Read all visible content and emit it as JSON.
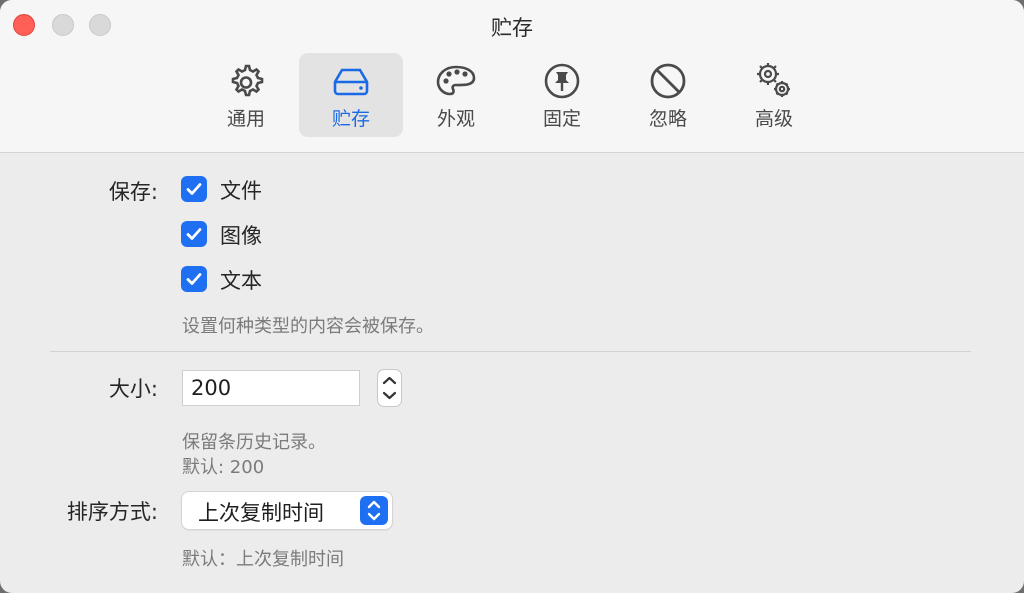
{
  "window": {
    "title": "贮存"
  },
  "tabs": [
    {
      "label": "通用",
      "icon": "gear-icon"
    },
    {
      "label": "贮存",
      "icon": "storage-drive-icon",
      "active": true
    },
    {
      "label": "外观",
      "icon": "palette-icon"
    },
    {
      "label": "固定",
      "icon": "pin-icon"
    },
    {
      "label": "忽略",
      "icon": "prohibited-icon"
    },
    {
      "label": "高级",
      "icon": "gears-icon"
    }
  ],
  "save": {
    "label": "保存:",
    "options": [
      {
        "label": "文件",
        "checked": true
      },
      {
        "label": "图像",
        "checked": true
      },
      {
        "label": "文本",
        "checked": true
      }
    ],
    "hint": "设置何种类型的内容会被保存。"
  },
  "size": {
    "label": "大小:",
    "value": "200",
    "hint": "保留条历史记录。",
    "default": "默认: 200"
  },
  "sort": {
    "label": "排序方式:",
    "value": "上次复制时间",
    "default": "默认：上次复制时间"
  },
  "colors": {
    "accent": "#1e6ff1",
    "close": "#fe5f57"
  }
}
